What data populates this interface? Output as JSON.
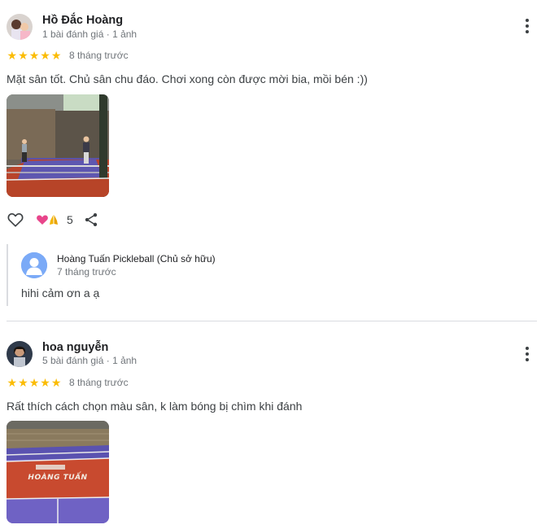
{
  "reviews": [
    {
      "author": "Hồ Đắc Hoàng",
      "meta": "1 bài đánh giá · 1 ảnh",
      "rating": 5,
      "stars": [
        "★",
        "★",
        "★",
        "★",
        "★"
      ],
      "time": "8 tháng trước",
      "text": "Mặt sân tốt. Chủ sân chu đáo. Chơi xong còn được mời bia, mồi bén :))",
      "reaction_count": "5",
      "reply": {
        "author": "Hoàng Tuấn Pickleball (Chủ sở hữu)",
        "time": "7 tháng trước",
        "text": "hihi cảm ơn a ạ"
      }
    },
    {
      "author": "hoa nguyễn",
      "meta": "5 bài đánh giá · 1 ảnh",
      "rating": 5,
      "stars": [
        "★",
        "★",
        "★",
        "★",
        "★"
      ],
      "time": "8 tháng trước",
      "text": "Rất thích cách chọn màu sân, k làm bóng bị chìm khi đánh",
      "photo_banner": "HOÀNG TUẤN"
    }
  ],
  "colors": {
    "star": "#fbbc04",
    "court_red": "#c84a2f",
    "court_purple": "#6f62c4",
    "divider": "#dadce0"
  },
  "icons": [
    "more-vert-icon",
    "heart-outline-icon",
    "share-icon",
    "love-react-icon",
    "pray-react-icon",
    "person-icon"
  ]
}
